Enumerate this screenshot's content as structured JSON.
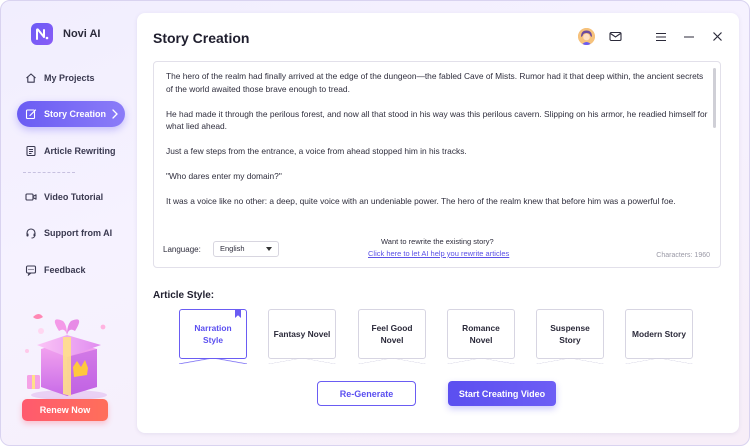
{
  "app": {
    "name": "Novi AI"
  },
  "colors": {
    "accent": "#6a5cf3",
    "renew": "#ff5a6e",
    "text": "#2f2e3d",
    "link": "#5b51e6"
  },
  "sidebar": {
    "items": [
      {
        "label": "My Projects",
        "icon": "home-icon",
        "active": false
      },
      {
        "label": "Story Creation",
        "icon": "edit-icon",
        "active": true
      },
      {
        "label": "Article Rewriting",
        "icon": "document-icon",
        "active": false
      },
      {
        "label": "Video Tutorial",
        "icon": "video-icon",
        "active": false
      },
      {
        "label": "Support from AI",
        "icon": "headset-icon",
        "active": false
      },
      {
        "label": "Feedback",
        "icon": "chat-icon",
        "active": false
      }
    ],
    "renew_label": "Renew Now"
  },
  "header": {
    "title": "Story Creation",
    "icons": [
      "avatar",
      "mail-icon",
      "menu-icon",
      "minimize-icon",
      "close-icon"
    ]
  },
  "story": {
    "paragraphs": [
      "The hero of the realm had finally arrived at the edge of the dungeon—the fabled Cave of Mists. Rumor had it that deep within, the ancient secrets of the world awaited those brave enough to tread.",
      "He had made it through the perilous forest, and now all that stood in his way was this perilous cavern. Slipping on his armor, he readied himself for what lied ahead.",
      "Just a few steps from the entrance, a voice from ahead stopped him in his tracks.",
      "\"Who dares enter my domain?\"",
      "It was a voice like no other: a deep, quite voice with an undeniable power. The hero of the realm knew that before him was a powerful foe."
    ],
    "language_label": "Language:",
    "language_value": "English",
    "rewrite_question": "Want to rewrite the existing story?",
    "rewrite_link": "Click here to let AI help you rewrite articles",
    "char_count": "Characters: 1960"
  },
  "article_style": {
    "title": "Article Style:",
    "options": [
      {
        "label": "Narration Style",
        "selected": true
      },
      {
        "label": "Fantasy Novel",
        "selected": false
      },
      {
        "label": "Feel Good Novel",
        "selected": false
      },
      {
        "label": "Romance Novel",
        "selected": false
      },
      {
        "label": "Suspense Story",
        "selected": false
      },
      {
        "label": "Modern Story",
        "selected": false
      }
    ]
  },
  "actions": {
    "regenerate_label": "Re-Generate",
    "create_label": "Start Creating Video"
  }
}
